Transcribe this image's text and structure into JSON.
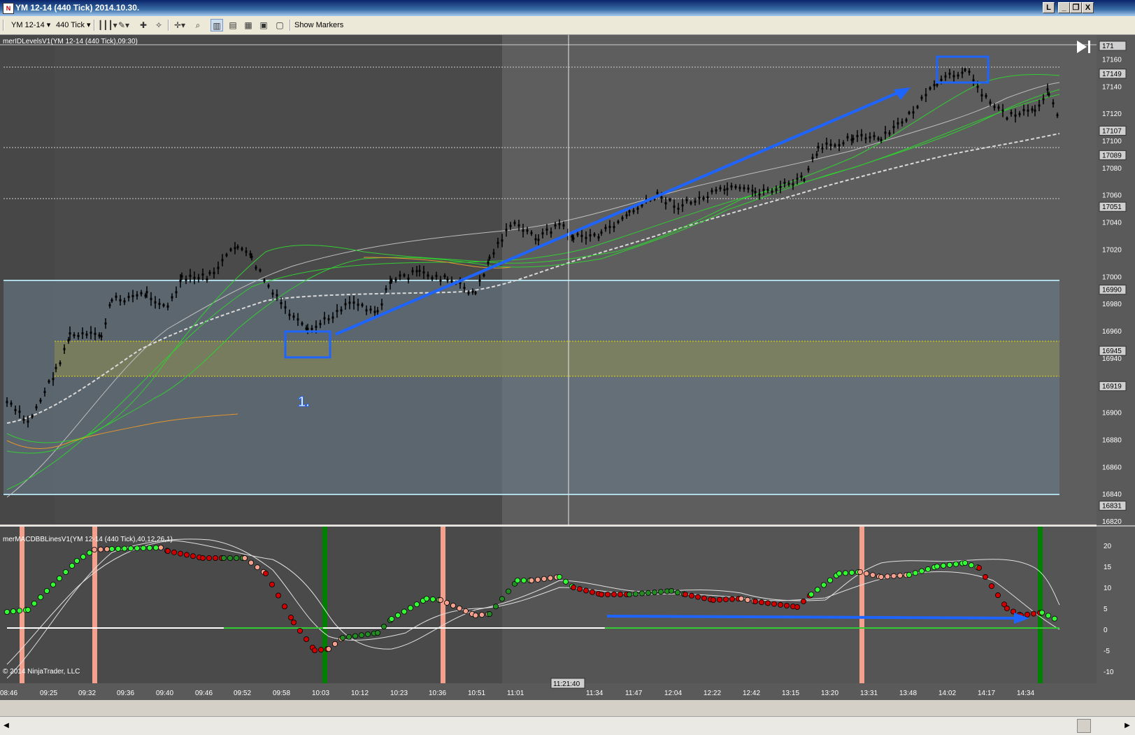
{
  "window": {
    "title": "YM 12-14 (440 Tick)  2014.10.30.",
    "buttons": [
      "L",
      "_",
      "❐",
      "X"
    ]
  },
  "toolbar": {
    "instrument": "YM 12-14",
    "interval": "440 Tick",
    "show_markers": "Show Markers"
  },
  "price_panel": {
    "indicator_label": "merIDLevelsV1(YM 12-14 (440 Tick),09:30)",
    "price_ticks": [
      17160,
      17140,
      17120,
      17100,
      17080,
      17060,
      17040,
      17020,
      17000,
      16980,
      16960,
      16940,
      16920,
      16900,
      16880,
      16860,
      16840,
      16820
    ],
    "level_badges": [
      "17149",
      "17107",
      "17089",
      "17051",
      "16990",
      "16945",
      "16919",
      "16831"
    ],
    "top_badge": "171",
    "annotation": "1.",
    "ylim": [
      16820,
      17170
    ]
  },
  "macd_panel": {
    "indicator_label": "merMACDBBLinesV1(YM 12-14 (440 Tick),40,12,26,1)",
    "ticks": [
      "20",
      "15",
      "10",
      "5",
      "0",
      "-5",
      "-10"
    ],
    "ylim": [
      -10,
      20
    ]
  },
  "time_axis": {
    "labels": [
      "08:46",
      "09:25",
      "09:32",
      "09:36",
      "09:40",
      "09:46",
      "09:52",
      "09:58",
      "10:03",
      "10:12",
      "10:23",
      "10:36",
      "10:51",
      "11:01",
      "11:34",
      "11:47",
      "12:04",
      "12:22",
      "12:42",
      "13:15",
      "13:20",
      "13:31",
      "13:48",
      "14:02",
      "14:17",
      "14:34"
    ],
    "cursor_label": "11:21:40"
  },
  "copyright": "© 2014 NinjaTrader, LLC",
  "colors": {
    "background": "#555555",
    "pre_session_bg": "#474747",
    "post_bg": "#5e5e5e",
    "range_band": "#6b7d8c",
    "yellow_zone": "#7a7a5a",
    "level_light_blue": "#add8e6",
    "arrow_blue": "#1e64ff",
    "green_line": "#32cd32",
    "orange_line": "#e6962d"
  }
}
